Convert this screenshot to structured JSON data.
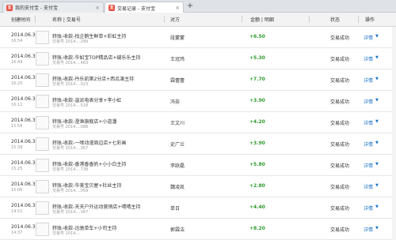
{
  "tabs": [
    {
      "logo": "支",
      "label": "我的支付宝 - 支付宝",
      "active": false
    },
    {
      "logo": "支",
      "label": "交易记录 - 支付宝",
      "active": true
    }
  ],
  "tab_close_glyph": "×",
  "tab_add_glyph": "+",
  "header": {
    "created_time": "创建时间",
    "name_txn": "名称 | 交易号",
    "party": "对方",
    "amount_detail": "金额 | 明细",
    "status": "状态",
    "action": "操作"
  },
  "rows": [
    {
      "date": "2014.06.30",
      "time": "16:54",
      "name": "转账-收款-找企鹅生鲜单+彩虹主持",
      "txn": "交易号 2014....289",
      "party": "段蒙蒙",
      "amount": "+6.50",
      "status": "交易成功",
      "detail": "详情"
    },
    {
      "date": "2014.06.30",
      "time": "16:49",
      "name": "转账-收款-华如宝TOP精品店+缝乐乐主持",
      "txn": "交易号 2014....463",
      "party": "王冠玮",
      "amount": "+5.30",
      "status": "交易成功",
      "detail": "详情"
    },
    {
      "date": "2014.06.30",
      "time": "16:25",
      "name": "转账-收款-丹乐凯第2分店+西瓜演主持",
      "txn": "交易号 2014....023",
      "party": "霖蕾蕾",
      "amount": "+7.70",
      "status": "交易成功",
      "detail": "详情"
    },
    {
      "date": "2014.06.30",
      "time": "16:12",
      "name": "转账-收款-温派电表分享+李小虹",
      "txn": "交易号 2014....518",
      "party": "冯奈",
      "amount": "+3.90",
      "status": "交易成功",
      "detail": "详情"
    },
    {
      "date": "2014.06.30",
      "time": "15:56",
      "name": "转账-收款-澄渔旗舰店+小道潘",
      "txn": "交易号 2014....088",
      "party": "王文川",
      "amount": "+4.20",
      "status": "交易成功",
      "detail": "详情"
    },
    {
      "date": "2014.06.30",
      "time": "15:39",
      "name": "转账-收款-一嗦动漫周边店+七彩画",
      "txn": "交易号 2014....367",
      "party": "史广兰",
      "amount": "+3.90",
      "status": "交易成功",
      "detail": "详情"
    },
    {
      "date": "2014.06.30",
      "time": "15:25",
      "name": "转账-收款-香港香香奶+小小白主持",
      "txn": "交易号 2014....738",
      "party": "李跃磊",
      "amount": "+5.80",
      "status": "交易成功",
      "detail": "详情"
    },
    {
      "date": "2014.06.30",
      "time": "15:06",
      "name": "转账-收款-华美宝贝屋+杜丝主持",
      "txn": "交易号 2014....059",
      "party": "魏凌凯",
      "amount": "+2.80",
      "status": "交易成功",
      "detail": "详情"
    },
    {
      "date": "2014.06.30",
      "time": "14:51",
      "name": "转账-收款-天天户外运动营销店+晴晴主持",
      "txn": "交易号 2014....367",
      "party": "单日",
      "amount": "+4.40",
      "status": "交易成功",
      "detail": "详情"
    },
    {
      "date": "2014.06.30",
      "time": "14:37",
      "name": "转账-收款-迅驰单车+小司主持",
      "txn": "交易号 2014....",
      "party": "郭霖洁",
      "amount": "+8.20",
      "status": "交易成功",
      "detail": "详情"
    }
  ],
  "caret_glyph": "▼",
  "colors": {
    "amount_positive": "#2e9b2e",
    "link": "#1a73c8",
    "tab_logo": "#e74c3c"
  }
}
